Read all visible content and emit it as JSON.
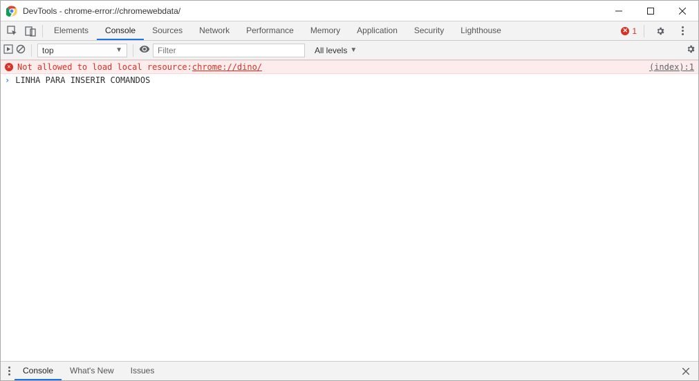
{
  "window": {
    "title": "DevTools - chrome-error://chromewebdata/"
  },
  "tabs": [
    {
      "label": "Elements"
    },
    {
      "label": "Console"
    },
    {
      "label": "Sources"
    },
    {
      "label": "Network"
    },
    {
      "label": "Performance"
    },
    {
      "label": "Memory"
    },
    {
      "label": "Application"
    },
    {
      "label": "Security"
    },
    {
      "label": "Lighthouse"
    }
  ],
  "active_tab": "Console",
  "error_count": "1",
  "console_toolbar": {
    "context": "top",
    "filter_placeholder": "Filter",
    "levels": "All levels"
  },
  "console": {
    "error_row": {
      "message": "Not allowed to load local resource: ",
      "link": "chrome://dino/",
      "source": "(index):1"
    },
    "input_row": {
      "text": "LINHA PARA INSERIR COMANDOS"
    }
  },
  "drawer": {
    "tabs": [
      {
        "label": "Console"
      },
      {
        "label": "What's New"
      },
      {
        "label": "Issues"
      }
    ],
    "active": "Console"
  }
}
